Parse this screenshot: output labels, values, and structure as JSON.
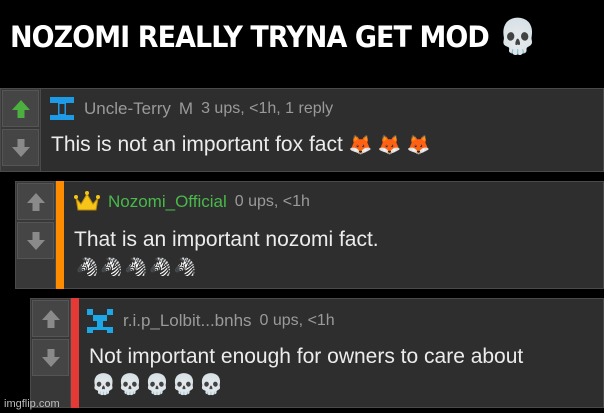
{
  "caption": {
    "text": "NOZOMI REALLY TRYNA GET MOD",
    "emoji": "💀"
  },
  "comments": [
    {
      "username": "Uncle-Terry",
      "badge": "M",
      "meta": "3 ups, <1h, 1 reply",
      "body": "This is not an important fox fact",
      "body_emoji": "🦊 🦊 🦊",
      "username_color": "#9a9a9a",
      "accent": "",
      "upvote_active": true,
      "avatar_icon": "t-icon"
    },
    {
      "username": "Nozomi_Official",
      "meta": "0 ups, <1h",
      "body": "That is an important nozomi fact.",
      "emoji_line": "🦓🦓🦓🦓🦓",
      "username_color": "#48b94a",
      "accent": "#ff8c00",
      "upvote_active": false,
      "avatar_icon": "crown-icon"
    },
    {
      "username": "r.i.p_Lolbit...bnhs",
      "meta": "0 ups, <1h",
      "body": "Not important enough for owners to care about",
      "emoji_line": "💀💀💀💀💀",
      "username_color": "#9a9a9a",
      "accent": "#e53935",
      "upvote_active": false,
      "avatar_icon": "pixel-avatar-icon"
    }
  ],
  "watermark": "imgflip.com"
}
